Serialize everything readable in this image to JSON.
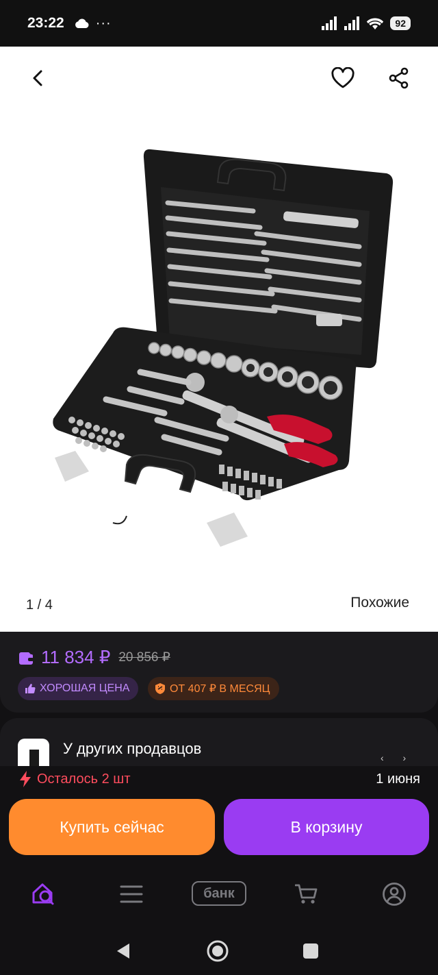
{
  "status_bar": {
    "time": "23:22",
    "battery": "92",
    "icons": [
      "cloud-icon",
      "more-dots-icon",
      "signal-icon",
      "signal-icon",
      "wifi-icon",
      "battery-icon"
    ]
  },
  "header": {
    "icons": [
      "back-arrow-icon",
      "heart-icon",
      "share-icon"
    ]
  },
  "gallery": {
    "counter": "1 / 4",
    "similar_label": "Похожие"
  },
  "price": {
    "current": "11 834 ₽",
    "old": "20 856 ₽",
    "badge_good": "ХОРОШАЯ ЦЕНА",
    "badge_month": "ОТ 407 ₽ В МЕСЯЦ",
    "colors": {
      "price": "#b36cff",
      "good_badge": "#c28bff",
      "month_badge": "#ff8a3a"
    }
  },
  "sellers": {
    "title": "У других продавцов"
  },
  "stock": {
    "remaining": "Осталось 2 шт",
    "delivery_date": "1 июня"
  },
  "actions": {
    "buy_now": "Купить сейчас",
    "add_to_cart": "В корзину",
    "colors": {
      "buy_now": "#ff8b2e",
      "add_to_cart": "#9a3cf2"
    }
  },
  "bottom_nav": {
    "items": [
      "home-search-icon",
      "catalog-menu-icon",
      "bank",
      "cart-icon",
      "profile-icon"
    ],
    "bank_label": "банк"
  },
  "system_nav": {
    "icons": [
      "system-back-icon",
      "system-home-icon",
      "system-recents-icon"
    ]
  }
}
